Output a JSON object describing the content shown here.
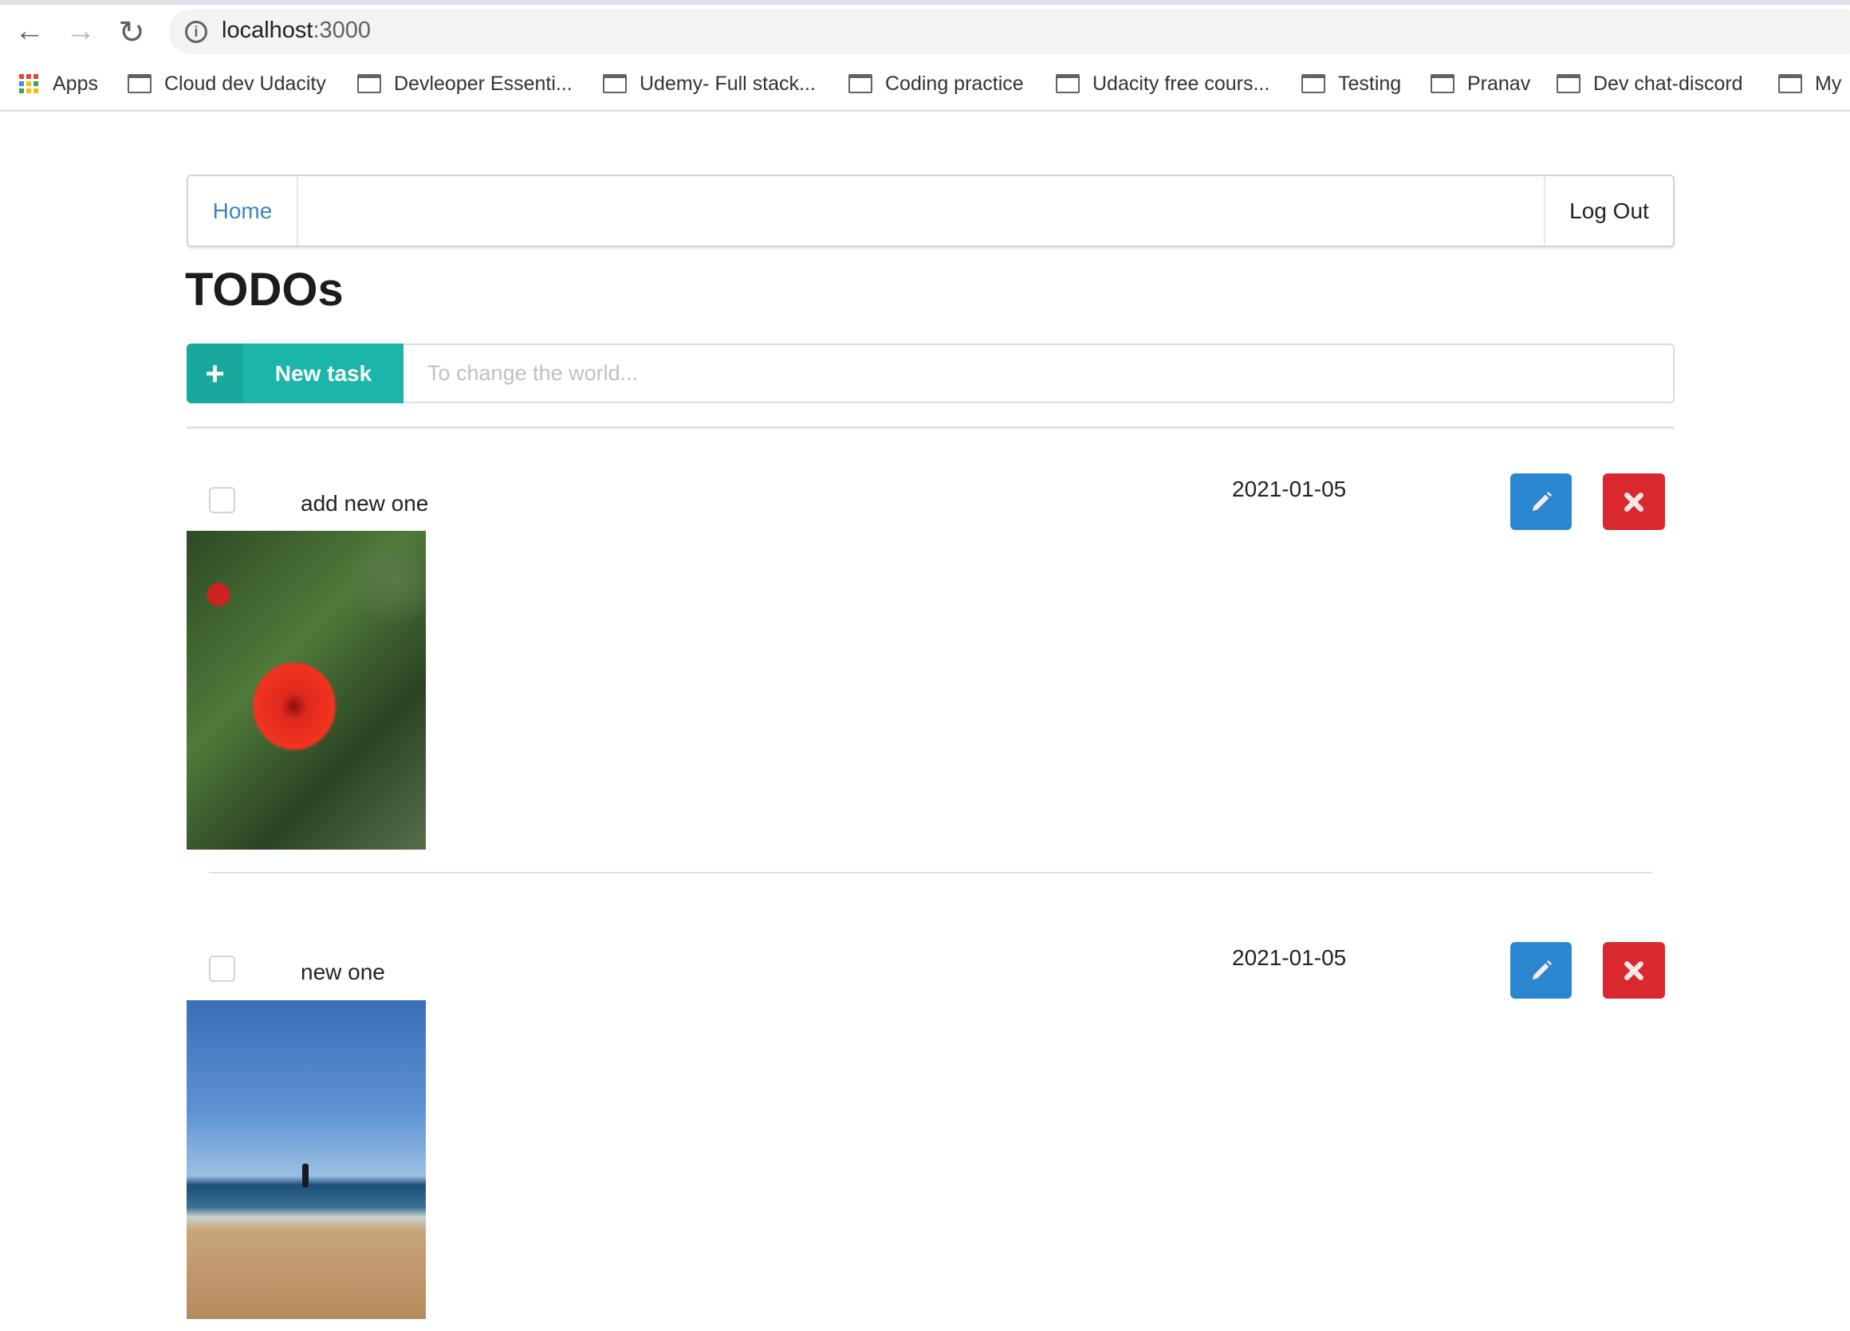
{
  "browser": {
    "url_host": "localhost",
    "url_port": ":3000",
    "bookmarks": [
      "Apps",
      "Cloud dev Udacity",
      "Devleoper Essenti...",
      "Udemy- Full stack...",
      "Coding practice",
      "Udacity free cours...",
      "Testing",
      "Pranav",
      "Dev chat-discord",
      "My"
    ]
  },
  "menu": {
    "home": "Home",
    "logout": "Log Out"
  },
  "page": {
    "title": "TODOs"
  },
  "new_task": {
    "label": "New task",
    "placeholder": "To change the world..."
  },
  "todos": [
    {
      "name": "add new one",
      "date": "2021-01-05",
      "done": false,
      "image": "hibiscus-flower"
    },
    {
      "name": "new one",
      "date": "2021-01-05",
      "done": false,
      "image": "beach"
    }
  ],
  "colors": {
    "accent": "#1bb5a9",
    "edit": "#2a87cf",
    "delete": "#d9292f",
    "link": "#4183c4"
  }
}
